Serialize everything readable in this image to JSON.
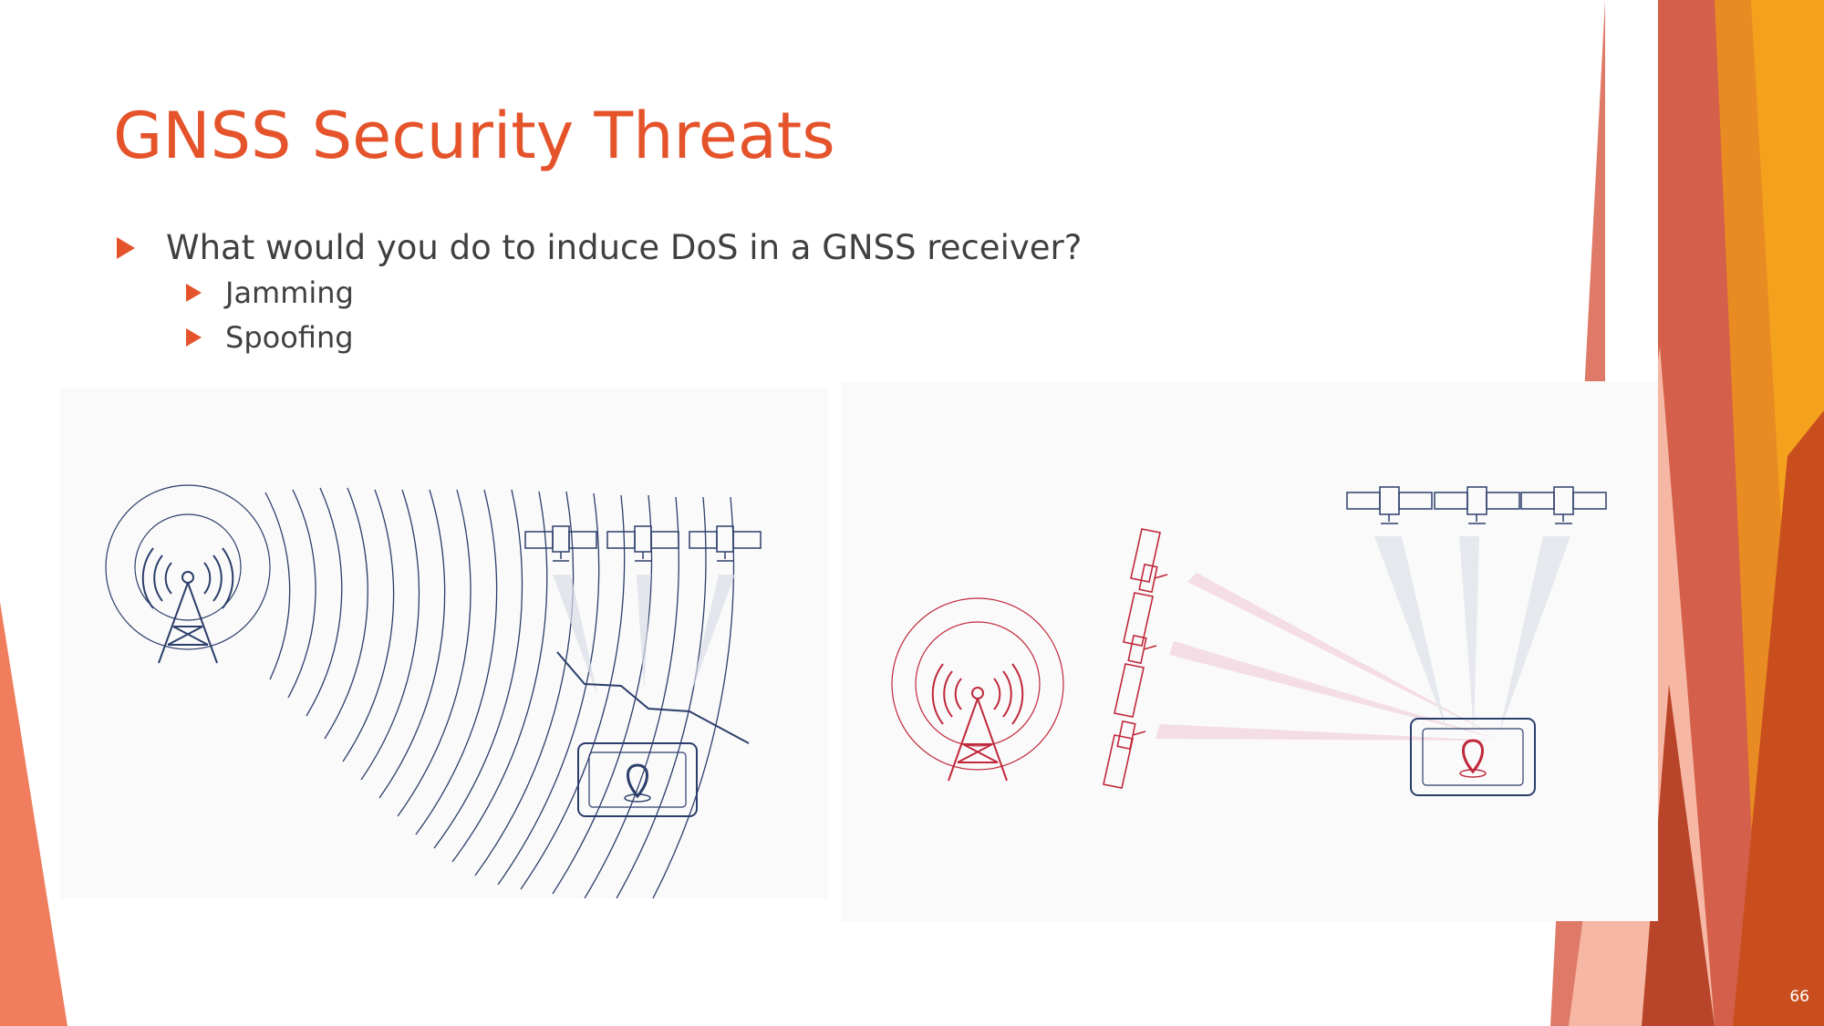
{
  "slide": {
    "title": "GNSS Security Threats",
    "bullets": {
      "main": "What would you do to induce DoS in a GNSS receiver?",
      "sub1": "Jamming",
      "sub2": "Spoofing"
    },
    "page_number": "66"
  },
  "illustrations": {
    "jamming": {
      "description_icons": [
        "radio-tower-icon",
        "satellite-icon",
        "gps-receiver-icon",
        "location-pin-icon"
      ],
      "color": "#2c3e6b"
    },
    "spoofing": {
      "description_icons": [
        "radio-tower-icon",
        "satellite-icon",
        "gps-receiver-icon",
        "location-pin-icon"
      ],
      "color": "#c0283b"
    }
  },
  "theme": {
    "accent": "#e5532b",
    "text": "#404040",
    "orange": "#f0a020",
    "salmon": "#f08070"
  }
}
